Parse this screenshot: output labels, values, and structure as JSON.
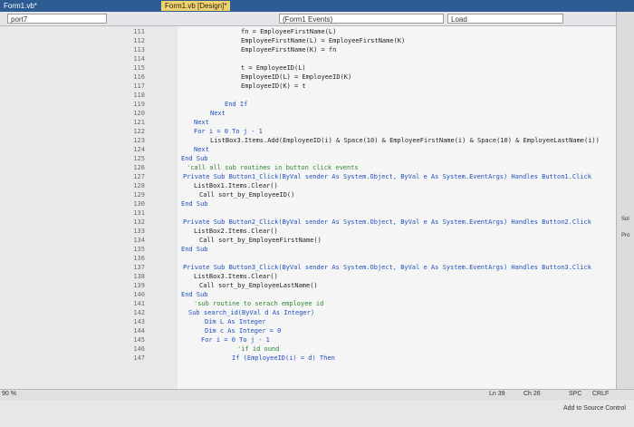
{
  "tabs": [
    {
      "label": "Form1.vb*"
    },
    {
      "label": "Form1.vb [Design]*"
    }
  ],
  "nav": {
    "project_combo": "port7",
    "events_combo": "(Form1 Events)",
    "method_combo": "Load"
  },
  "code": {
    "lines": [
      {
        "no": "111",
        "text": "fn = EmployeeFirstName(L)",
        "cls": ""
      },
      {
        "no": "112",
        "text": "EmployeeFirstName(L) = EmployeeFirstName(K)",
        "cls": ""
      },
      {
        "no": "113",
        "text": "EmployeeFirstName(K) = fn",
        "cls": ""
      },
      {
        "no": "114",
        "text": "",
        "cls": ""
      },
      {
        "no": "115",
        "text": "t = EmployeeID(L)",
        "cls": ""
      },
      {
        "no": "116",
        "text": "EmployeeID(L) = EmployeeID(K)",
        "cls": ""
      },
      {
        "no": "117",
        "text": "EmployeeID(K) = t",
        "cls": ""
      },
      {
        "no": "118",
        "text": "",
        "cls": ""
      },
      {
        "no": "119",
        "text": "End If",
        "cls": "kw"
      },
      {
        "no": "120",
        "text": "Next",
        "cls": "kw"
      },
      {
        "no": "121",
        "text": "Next",
        "cls": "kw"
      },
      {
        "no": "122",
        "text": "For i = 0 To j - 1",
        "cls": "kw"
      },
      {
        "no": "123",
        "text": "ListBox3.Items.Add(EmployeeID(i) & Space(10) & EmployeeFirstName(i) & Space(10) & EmployeeLastName(i))",
        "cls": ""
      },
      {
        "no": "124",
        "text": "Next",
        "cls": "kw"
      },
      {
        "no": "125",
        "text": "End Sub",
        "cls": "kw"
      },
      {
        "no": "126",
        "text": "'call all sub routines in button click events",
        "cls": "cm"
      },
      {
        "no": "127",
        "text": "Private Sub Button1_Click(ByVal sender As System.Object, ByVal e As System.EventArgs) Handles Button1.Click",
        "cls": "kw"
      },
      {
        "no": "128",
        "text": "ListBox1.Items.Clear()",
        "cls": ""
      },
      {
        "no": "129",
        "text": "Call sort_by_EmployeeID()",
        "cls": ""
      },
      {
        "no": "130",
        "text": "End Sub",
        "cls": "kw"
      },
      {
        "no": "131",
        "text": "",
        "cls": ""
      },
      {
        "no": "132",
        "text": "Private Sub Button2_Click(ByVal sender As System.Object, ByVal e As System.EventArgs) Handles Button2.Click",
        "cls": "kw"
      },
      {
        "no": "133",
        "text": "ListBox2.Items.Clear()",
        "cls": ""
      },
      {
        "no": "134",
        "text": "Call sort_by_EmployeeFirstName()",
        "cls": ""
      },
      {
        "no": "135",
        "text": "End Sub",
        "cls": "kw"
      },
      {
        "no": "136",
        "text": "",
        "cls": ""
      },
      {
        "no": "137",
        "text": "Private Sub Button3_Click(ByVal sender As System.Object, ByVal e As System.EventArgs) Handles Button3.Click",
        "cls": "kw"
      },
      {
        "no": "138",
        "text": "ListBox3.Items.Clear()",
        "cls": ""
      },
      {
        "no": "139",
        "text": "Call sort_by_EmployeeLastName()",
        "cls": ""
      },
      {
        "no": "140",
        "text": "End Sub",
        "cls": "kw"
      },
      {
        "no": "141",
        "text": "'sub routine to serach employee id",
        "cls": "cm"
      },
      {
        "no": "142",
        "text": "Sub search_id(ByVal d As Integer)",
        "cls": "kw"
      },
      {
        "no": "143",
        "text": "Dim L As Integer",
        "cls": "kw"
      },
      {
        "no": "144",
        "text": "Dim c As Integer = 0",
        "cls": "kw"
      },
      {
        "no": "145",
        "text": "For i = 0 To j - 1",
        "cls": "kw"
      },
      {
        "no": "146",
        "text": "'if id ound",
        "cls": "cm"
      },
      {
        "no": "147",
        "text": "If (EmployeeID(i) = d) Then",
        "cls": "kw"
      }
    ]
  },
  "status": {
    "zoom": "90 %",
    "line": "Ln 39",
    "col": "Ch 26",
    "spc": "SPC",
    "crlf": "CRLF",
    "source": "Add to Source Control"
  },
  "right_labels": [
    "Sol",
    "Pro"
  ]
}
